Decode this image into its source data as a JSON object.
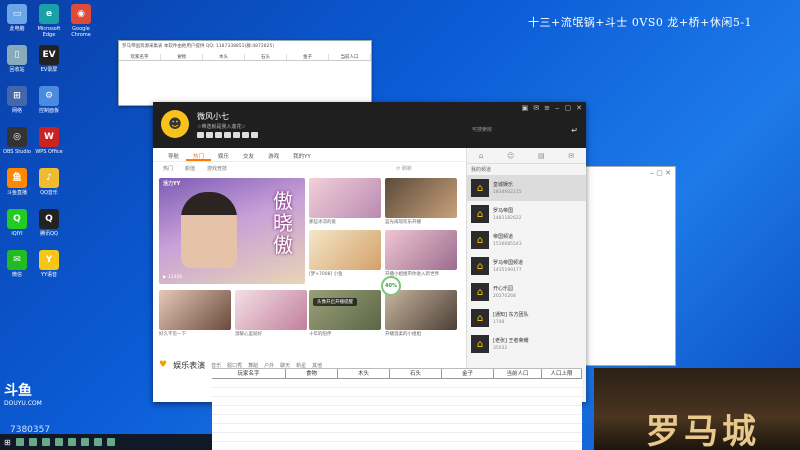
{
  "overlay_title": "十三+流氓锅+斗士 0VS0 龙+桥+休闲5-1",
  "desktop_icons": [
    {
      "label": "此电脑",
      "color": "#6aa6e8",
      "glyph": "▭"
    },
    {
      "label": "Microsoft Edge",
      "color": "#1aa0a8",
      "glyph": "e"
    },
    {
      "label": "Google Chrome",
      "color": "#e04a3a",
      "glyph": "◉"
    },
    {
      "label": "回收站",
      "color": "#8ab",
      "glyph": "▯"
    },
    {
      "label": "EV录屏",
      "color": "#222",
      "glyph": "EV"
    },
    {
      "label": "网络",
      "color": "#46a",
      "glyph": "⊞"
    },
    {
      "label": "控制面板",
      "color": "#4a8ae0",
      "glyph": "⚙"
    },
    {
      "label": "OBS Studio",
      "color": "#333",
      "glyph": "◎"
    },
    {
      "label": "WPS Office",
      "color": "#c22",
      "glyph": "W"
    },
    {
      "label": "斗鱼直播",
      "color": "#f80",
      "glyph": "鱼"
    },
    {
      "label": "QQ音乐",
      "color": "#eb3",
      "glyph": "♪"
    },
    {
      "label": "iQIYI",
      "color": "#2c2",
      "glyph": "Q"
    },
    {
      "label": "腾讯QQ",
      "color": "#222",
      "glyph": "Q"
    },
    {
      "label": "微信",
      "color": "#2b2",
      "glyph": "✉"
    },
    {
      "label": "YY语音",
      "color": "#f5c518",
      "glyph": "Y"
    }
  ],
  "sheet_window": {
    "title": "罗马帝国资源采集表  本软件由他用户提供  QQ: 1187338851(群:4872825)",
    "columns": [
      "玩家名字",
      "食物",
      "木头",
      "石头",
      "金子",
      "当前人口"
    ]
  },
  "main_window": {
    "username": "微风小七",
    "subtitle": "☆帝选就是我入莲花☆",
    "search_placeholder": "可搜索房",
    "nav_tabs": [
      "导航",
      "热门",
      "娱乐",
      "交友",
      "游戏",
      "我的YY"
    ],
    "active_tab": "热门",
    "sub_tabs": [
      "热门",
      "颜值",
      "游戏竞技"
    ],
    "refresh_label": "刷新",
    "featured": {
      "brand": "活力YY",
      "title": "傲晓傲",
      "meta": "▶ 12446"
    },
    "thumbs": [
      {
        "caption": "那些冰凉的爱",
        "color1": "#f2d0d9",
        "color2": "#b98ab1"
      },
      {
        "caption": "蓝光再现欢乐开播",
        "color1": "#5b4a3a",
        "color2": "#c9a27a"
      },
      {
        "caption": "[梦+7008] 小鱼",
        "color1": "#f5e7c8",
        "color2": "#d4a06a"
      },
      {
        "caption": "开播小姐姐带你进入新世界",
        "color1": "#f0c6d2",
        "color2": "#9b6c8e"
      },
      {
        "caption": "好久不见一下",
        "color1": "#e7c7b7",
        "color2": "#6a4a3a"
      },
      {
        "caption": "温暖心里就好",
        "color1": "#f4e0e6",
        "color2": "#c17f9a"
      },
      {
        "caption": "十年的陪伴",
        "color1": "#9aa078",
        "color2": "#5c6648"
      },
      {
        "caption": "开播温柔的小姐姐",
        "color1": "#c9b5a0",
        "color2": "#4c3f36"
      }
    ],
    "progress_label": "40%",
    "toast": "头像开启开播提醒",
    "bottom_title": "娱乐表演",
    "bottom_tags": [
      "音乐",
      "脱口秀",
      "舞蹈",
      "户外",
      "聊天",
      "新星",
      "其他"
    ]
  },
  "side_panel": {
    "group_label": "我的频道",
    "friends": [
      {
        "name": "皇城娱乐",
        "num": "1834602215",
        "selected": true
      },
      {
        "name": "罗马帝国",
        "num": "1481182622",
        "selected": false
      },
      {
        "name": "帝国频道",
        "num": "1536085543",
        "selected": false
      },
      {
        "name": "罗马帝国频道",
        "num": "1435199177",
        "selected": false
      },
      {
        "name": "开心乐园",
        "num": "20270268",
        "selected": false
      },
      {
        "name": "[通知] 东方团队",
        "num": "1748",
        "selected": false
      },
      {
        "name": "[老张] 王者荣耀",
        "num": "35032",
        "selected": false
      }
    ]
  },
  "bottom_sheet": {
    "columns": [
      "玩家名字",
      "食物",
      "木头",
      "石头",
      "金子",
      "当前人口",
      "人口上限"
    ]
  },
  "banner_text": "罗马城",
  "watermark": {
    "logo": "斗鱼",
    "site": "DOUYU.COM",
    "room_id": "7380357"
  }
}
